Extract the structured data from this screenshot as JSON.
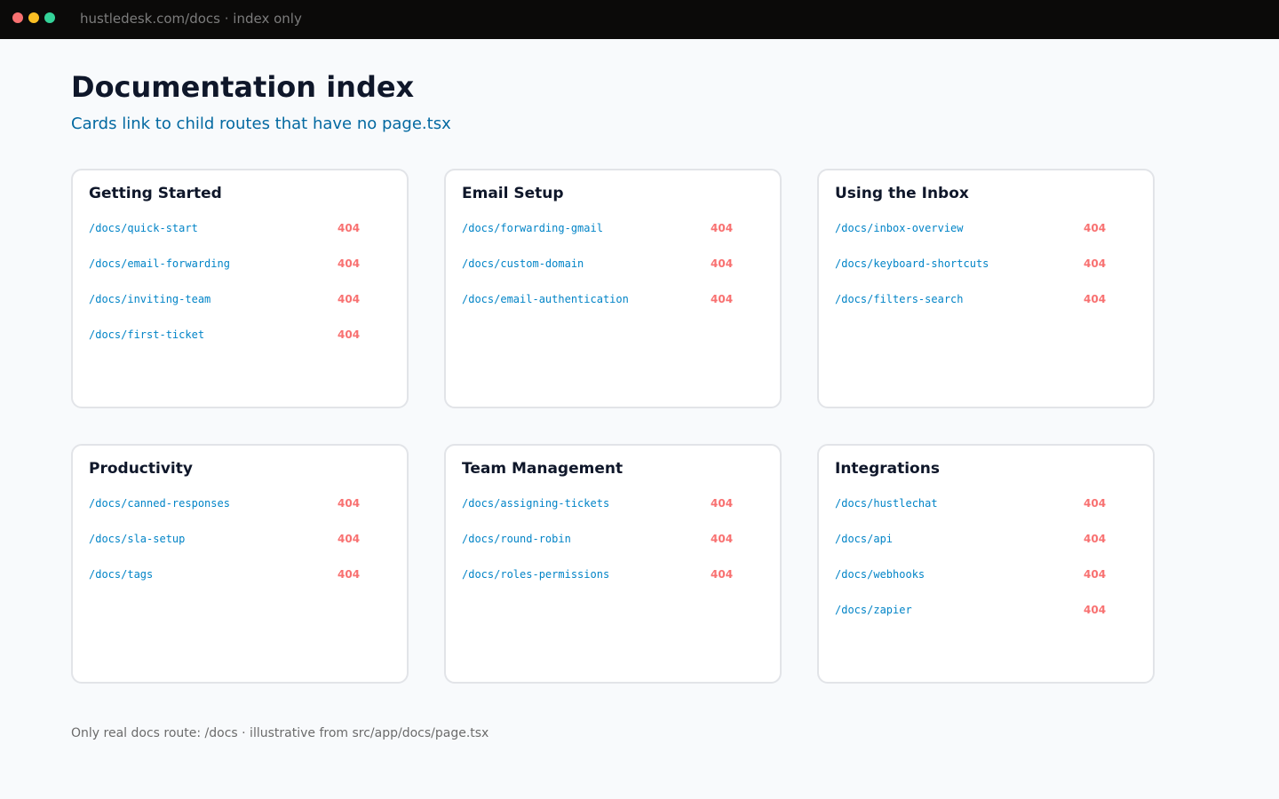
{
  "window": {
    "url": "hustledesk.com/docs · index only",
    "dot_colors": [
      "#f87171",
      "#fbbf24",
      "#34d399"
    ]
  },
  "header": {
    "title": "Documentation index",
    "subtitle": "Cards link to child routes that have no page.tsx"
  },
  "cards": [
    {
      "title": "Getting Started",
      "routes": [
        {
          "path": "/docs/quick-start",
          "status": "404"
        },
        {
          "path": "/docs/email-forwarding",
          "status": "404"
        },
        {
          "path": "/docs/inviting-team",
          "status": "404"
        },
        {
          "path": "/docs/first-ticket",
          "status": "404"
        }
      ]
    },
    {
      "title": "Email Setup",
      "routes": [
        {
          "path": "/docs/forwarding-gmail",
          "status": "404"
        },
        {
          "path": "/docs/custom-domain",
          "status": "404"
        },
        {
          "path": "/docs/email-authentication",
          "status": "404"
        }
      ]
    },
    {
      "title": "Using the Inbox",
      "routes": [
        {
          "path": "/docs/inbox-overview",
          "status": "404"
        },
        {
          "path": "/docs/keyboard-shortcuts",
          "status": "404"
        },
        {
          "path": "/docs/filters-search",
          "status": "404"
        }
      ]
    },
    {
      "title": "Productivity",
      "routes": [
        {
          "path": "/docs/canned-responses",
          "status": "404"
        },
        {
          "path": "/docs/sla-setup",
          "status": "404"
        },
        {
          "path": "/docs/tags",
          "status": "404"
        }
      ]
    },
    {
      "title": "Team Management",
      "routes": [
        {
          "path": "/docs/assigning-tickets",
          "status": "404"
        },
        {
          "path": "/docs/round-robin",
          "status": "404"
        },
        {
          "path": "/docs/roles-permissions",
          "status": "404"
        }
      ]
    },
    {
      "title": "Integrations",
      "routes": [
        {
          "path": "/docs/hustlechat",
          "status": "404"
        },
        {
          "path": "/docs/api",
          "status": "404"
        },
        {
          "path": "/docs/webhooks",
          "status": "404"
        },
        {
          "path": "/docs/zapier",
          "status": "404"
        }
      ]
    }
  ],
  "footer": {
    "text": "Only real docs route: /docs  ·  illustrative from src/app/docs/page.tsx"
  }
}
